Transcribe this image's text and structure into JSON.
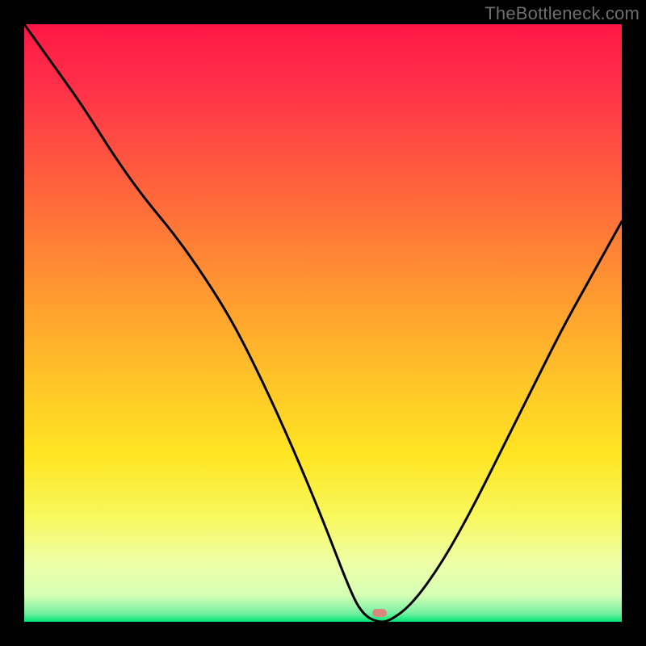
{
  "watermark": "TheBottleneck.com",
  "marker": {
    "x_frac": 0.595,
    "y_frac": 0.985
  },
  "gradient_stops": [
    {
      "offset": 0.0,
      "color": "#ff1744"
    },
    {
      "offset": 0.1,
      "color": "#ff2f4a"
    },
    {
      "offset": 0.22,
      "color": "#ff5340"
    },
    {
      "offset": 0.35,
      "color": "#ff7a37"
    },
    {
      "offset": 0.48,
      "color": "#ffa22e"
    },
    {
      "offset": 0.6,
      "color": "#ffc528"
    },
    {
      "offset": 0.72,
      "color": "#ffe522"
    },
    {
      "offset": 0.82,
      "color": "#f8f75a"
    },
    {
      "offset": 0.9,
      "color": "#efffa6"
    },
    {
      "offset": 0.955,
      "color": "#d6ffb5"
    },
    {
      "offset": 0.985,
      "color": "#7af0a2"
    },
    {
      "offset": 1.0,
      "color": "#00e676"
    }
  ],
  "chart_data": {
    "type": "line",
    "title": "",
    "xlabel": "",
    "ylabel": "",
    "xlim": [
      0,
      100
    ],
    "ylim": [
      0,
      100
    ],
    "grid": false,
    "legend": false,
    "annotations": [
      "TheBottleneck.com"
    ],
    "series": [
      {
        "name": "bottleneck-curve",
        "x": [
          0,
          5,
          10,
          15,
          20,
          25,
          30,
          35,
          40,
          45,
          50,
          55,
          57,
          59,
          61,
          65,
          70,
          75,
          80,
          85,
          90,
          95,
          100
        ],
        "y": [
          100,
          93,
          86,
          78,
          71,
          65,
          58,
          50,
          40,
          29,
          17,
          4,
          1,
          0,
          0,
          3,
          10,
          19,
          29,
          39,
          49,
          58,
          67
        ]
      }
    ],
    "optimum_marker": {
      "x": 59.5,
      "y": 0
    },
    "background": "vertical-gradient-red-to-green"
  }
}
